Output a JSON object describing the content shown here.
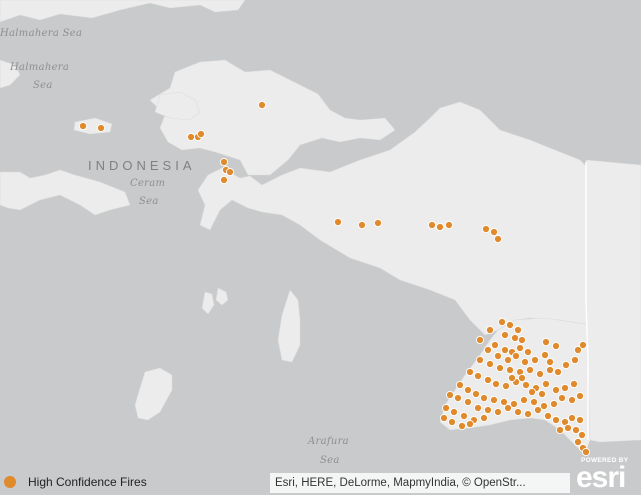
{
  "map": {
    "labels": {
      "country": "INDONESIA",
      "halmahera_sea_top": "Halmahera Sea",
      "halmahera_line1": "Halmahera",
      "halmahera_line2": "Sea",
      "ceram_line1": "Ceram",
      "ceram_line2": "Sea",
      "arafura_line1": "Arafura",
      "arafura_line2": "Sea"
    },
    "colors": {
      "water": "#c9cacb",
      "land": "#ececec",
      "fire": "#e08a2e",
      "border": "#ffffff"
    }
  },
  "legend": {
    "label": "High Confidence Fires",
    "icon": "circle-marker-icon"
  },
  "attribution": "Esri, HERE, DeLorme, MapmyIndia, © OpenStr...",
  "esri_logo": {
    "powered_by": "POWERED BY",
    "wordmark": "esri"
  }
}
